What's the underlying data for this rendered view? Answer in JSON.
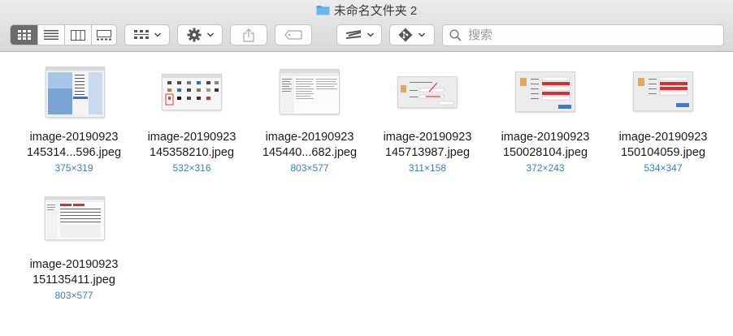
{
  "window": {
    "title": "未命名文件夹 2"
  },
  "toolbar": {
    "view_buttons": [
      "icon-view",
      "list-view",
      "column-view",
      "gallery-view"
    ],
    "search_placeholder": "搜索"
  },
  "files": [
    {
      "name_line1": "image-20190923",
      "name_line2": "145314...596.jpeg",
      "dims": "375×319"
    },
    {
      "name_line1": "image-20190923",
      "name_line2": "145358210.jpeg",
      "dims": "532×316"
    },
    {
      "name_line1": "image-20190923",
      "name_line2": "145440...682.jpeg",
      "dims": "803×577"
    },
    {
      "name_line1": "image-20190923",
      "name_line2": "145713987.jpeg",
      "dims": "311×158"
    },
    {
      "name_line1": "image-20190923",
      "name_line2": "150028104.jpeg",
      "dims": "372×243"
    },
    {
      "name_line1": "image-20190923",
      "name_line2": "150104059.jpeg",
      "dims": "534×347"
    },
    {
      "name_line1": "image-20190923",
      "name_line2": "151135411.jpeg",
      "dims": "803×577"
    }
  ],
  "colors": {
    "accent": "#3a7bd5",
    "folder": "#4ea6ea",
    "selected_segment": "#6c6c6c"
  }
}
